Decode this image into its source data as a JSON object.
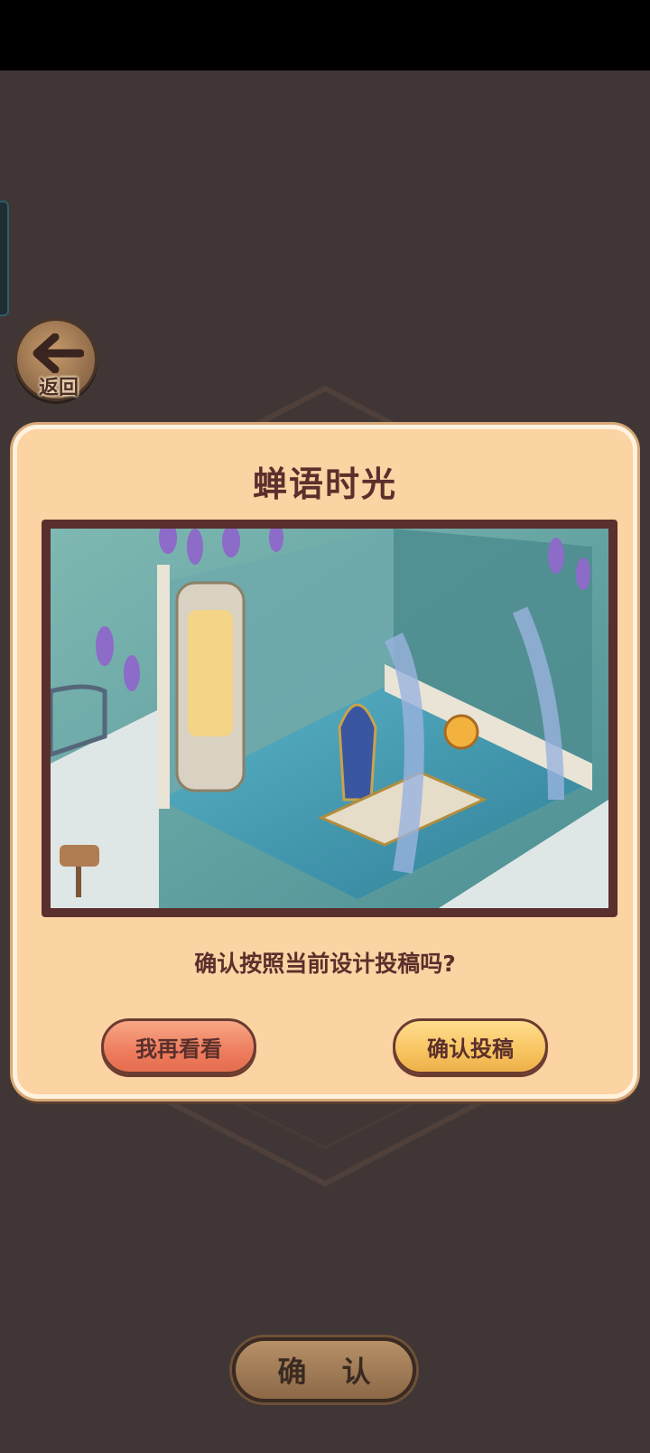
{
  "back": {
    "label": "返回"
  },
  "dialog": {
    "title": "蝉语时光",
    "question": "确认按照当前设计投稿吗?",
    "cancel_label": "我再看看",
    "confirm_label": "确认投稿"
  },
  "bottom": {
    "confirm_label": "确 认"
  },
  "colors": {
    "background": "#3f3635",
    "dialog_bg": "#fcd3a3",
    "title_text": "#5b2f2b",
    "cancel_button": "#ee7d5e",
    "confirm_button": "#f7c460"
  }
}
